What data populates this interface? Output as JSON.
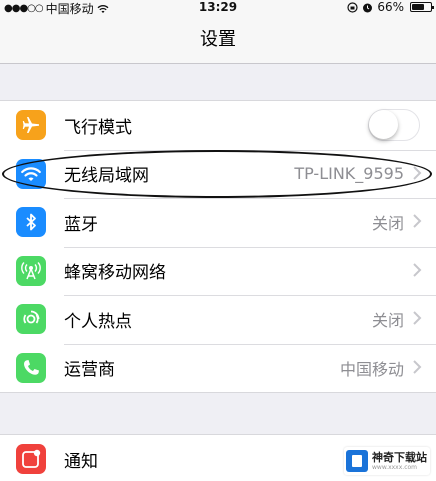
{
  "status_bar": {
    "carrier": "中国移动",
    "time": "13:29",
    "battery": "66%",
    "battery_level": 0.66,
    "icons": [
      "signal-dots-icon",
      "wifi-icon",
      "rotation-lock-icon",
      "alarm-icon",
      "battery-icon"
    ]
  },
  "nav": {
    "title": "设置"
  },
  "group1": {
    "items": [
      {
        "label": "飞行模式",
        "value": "",
        "icon": "airplane-icon",
        "color": "#f7a21b",
        "control": "toggle",
        "toggle_on": false
      },
      {
        "label": "无线局域网",
        "value": "TP-LINK_9595",
        "icon": "wifi-icon",
        "color": "#1a8cff",
        "control": "chevron"
      },
      {
        "label": "蓝牙",
        "value": "关闭",
        "icon": "bluetooth-icon",
        "color": "#1a8cff",
        "control": "chevron"
      },
      {
        "label": "蜂窝移动网络",
        "value": "",
        "icon": "cellular-icon",
        "color": "#4cd964",
        "control": "chevron"
      },
      {
        "label": "个人热点",
        "value": "关闭",
        "icon": "hotspot-icon",
        "color": "#4cd964",
        "control": "chevron"
      },
      {
        "label": "运营商",
        "value": "中国移动",
        "icon": "phone-icon",
        "color": "#4cd964",
        "control": "chevron"
      }
    ]
  },
  "group2": {
    "items": [
      {
        "label": "通知",
        "value": "",
        "icon": "notifications-icon",
        "color": "#f0413c",
        "control": "chevron"
      }
    ]
  },
  "watermark": {
    "title": "神奇下载站",
    "url": "www.xxxx.com"
  }
}
